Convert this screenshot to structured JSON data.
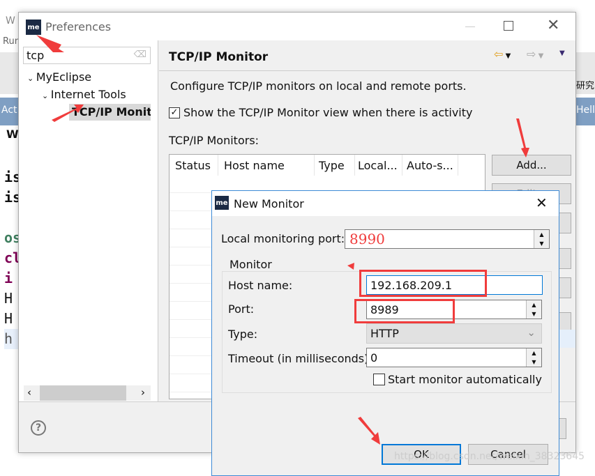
{
  "background": {
    "left_fragments": [
      "W",
      "Run",
      "Act",
      "W",
      "is",
      "is",
      "os",
      "cl",
      "i",
      "H",
      "H",
      "h"
    ],
    "right_fragments": [
      "研究",
      "Hell"
    ]
  },
  "preferences": {
    "title": "Preferences",
    "search_value": "tcp",
    "tree": [
      {
        "label": "MyEclipse"
      },
      {
        "label": "Internet Tools"
      },
      {
        "label": "TCP/IP Monitor"
      }
    ],
    "page_title": "TCP/IP Monitor",
    "description": "Configure TCP/IP monitors on local and remote ports.",
    "show_view_label": "Show the TCP/IP Monitor view when there is activity",
    "show_view_checked": true,
    "monitors_label": "TCP/IP Monitors:",
    "columns": [
      "Status",
      "Host name",
      "Type",
      "Local...",
      "Auto-s..."
    ],
    "buttons": {
      "add": "Add...",
      "edit": "Edit..."
    }
  },
  "dialog": {
    "title": "New Monitor",
    "local_port_label": "Local monitoring port:",
    "local_port_value": "8990",
    "group_label": "Monitor",
    "host_label": "Host name:",
    "host_value": "192.168.209.1",
    "port_label": "Port:",
    "port_value": "8989",
    "type_label": "Type:",
    "type_value": "HTTP",
    "timeout_label": "Timeout (in milliseconds):",
    "timeout_value": "0",
    "auto_start_label": "Start monitor automatically",
    "auto_start_checked": false,
    "ok": "OK",
    "cancel": "Cancel"
  },
  "watermark": "https://blog.csdn.net/weixin_38323645",
  "colors": {
    "annotation": "#f03c3c",
    "focus": "#0078d7"
  }
}
